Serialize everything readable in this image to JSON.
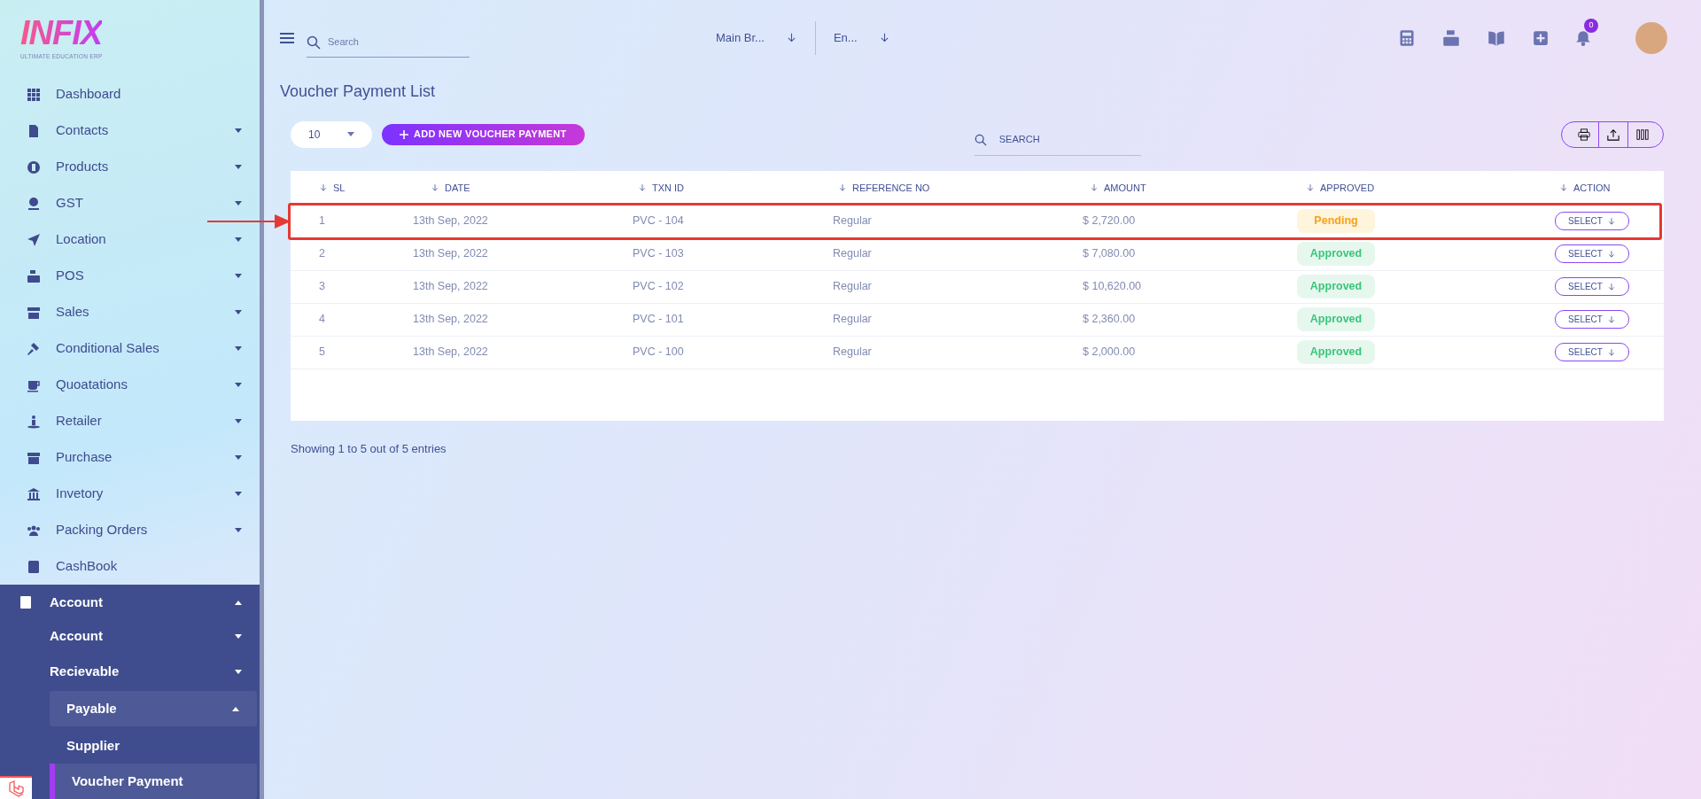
{
  "logo": {
    "title": "INFIX",
    "subtitle": "ULTIMATE EDUCATION ERP"
  },
  "sidebar": {
    "items": [
      {
        "label": "Dashboard"
      },
      {
        "label": "Contacts",
        "expanded": false
      },
      {
        "label": "Products",
        "expanded": false
      },
      {
        "label": "GST",
        "expanded": false
      },
      {
        "label": "Location",
        "expanded": false
      },
      {
        "label": "POS",
        "expanded": false
      },
      {
        "label": "Sales",
        "expanded": false
      },
      {
        "label": "Conditional Sales",
        "expanded": false
      },
      {
        "label": "Quoatations",
        "expanded": false
      },
      {
        "label": "Retailer",
        "expanded": false
      },
      {
        "label": "Purchase",
        "expanded": false
      },
      {
        "label": "Invetory",
        "expanded": false
      },
      {
        "label": "Packing Orders",
        "expanded": false
      },
      {
        "label": "CashBook"
      },
      {
        "label": "Account",
        "expanded": true,
        "children": [
          {
            "label": "Account",
            "expanded": false
          },
          {
            "label": "Recievable",
            "expanded": false
          },
          {
            "label": "Payable",
            "expanded": true,
            "children": [
              {
                "label": "Supplier",
                "selected": false
              },
              {
                "label": "Voucher Payment",
                "selected": true
              }
            ]
          }
        ]
      }
    ]
  },
  "header": {
    "search": {
      "placeholder": "Search"
    },
    "branch": "Main Br...",
    "language": "En...",
    "notification_count": "0"
  },
  "page_title": "Voucher Payment List",
  "toolbar": {
    "page_size": "10",
    "add_button": "ADD NEW VOUCHER PAYMENT",
    "search": {
      "placeholder": "SEARCH"
    }
  },
  "table": {
    "columns": [
      "SL",
      "DATE",
      "TXN ID",
      "REFERENCE NO",
      "AMOUNT",
      "APPROVED",
      "ACTION"
    ],
    "rows": [
      {
        "sl": "1",
        "date": "13th Sep, 2022",
        "txn_id": "PVC - 104",
        "reference": "Regular",
        "amount": "$ 2,720.00",
        "status": "Pending",
        "kind": "pending",
        "action": "SELECT",
        "highlighted": true
      },
      {
        "sl": "2",
        "date": "13th Sep, 2022",
        "txn_id": "PVC - 103",
        "reference": "Regular",
        "amount": "$ 7,080.00",
        "status": "Approved",
        "kind": "approved",
        "action": "SELECT",
        "highlighted": false
      },
      {
        "sl": "3",
        "date": "13th Sep, 2022",
        "txn_id": "PVC - 102",
        "reference": "Regular",
        "amount": "$ 10,620.00",
        "status": "Approved",
        "kind": "approved",
        "action": "SELECT",
        "highlighted": false
      },
      {
        "sl": "4",
        "date": "13th Sep, 2022",
        "txn_id": "PVC - 101",
        "reference": "Regular",
        "amount": "$ 2,360.00",
        "status": "Approved",
        "kind": "approved",
        "action": "SELECT",
        "highlighted": false
      },
      {
        "sl": "5",
        "date": "13th Sep, 2022",
        "txn_id": "PVC - 100",
        "reference": "Regular",
        "amount": "$ 2,000.00",
        "status": "Approved",
        "kind": "approved",
        "action": "SELECT",
        "highlighted": false
      }
    ]
  },
  "footer": "Showing 1 to 5 out of 5 entries"
}
